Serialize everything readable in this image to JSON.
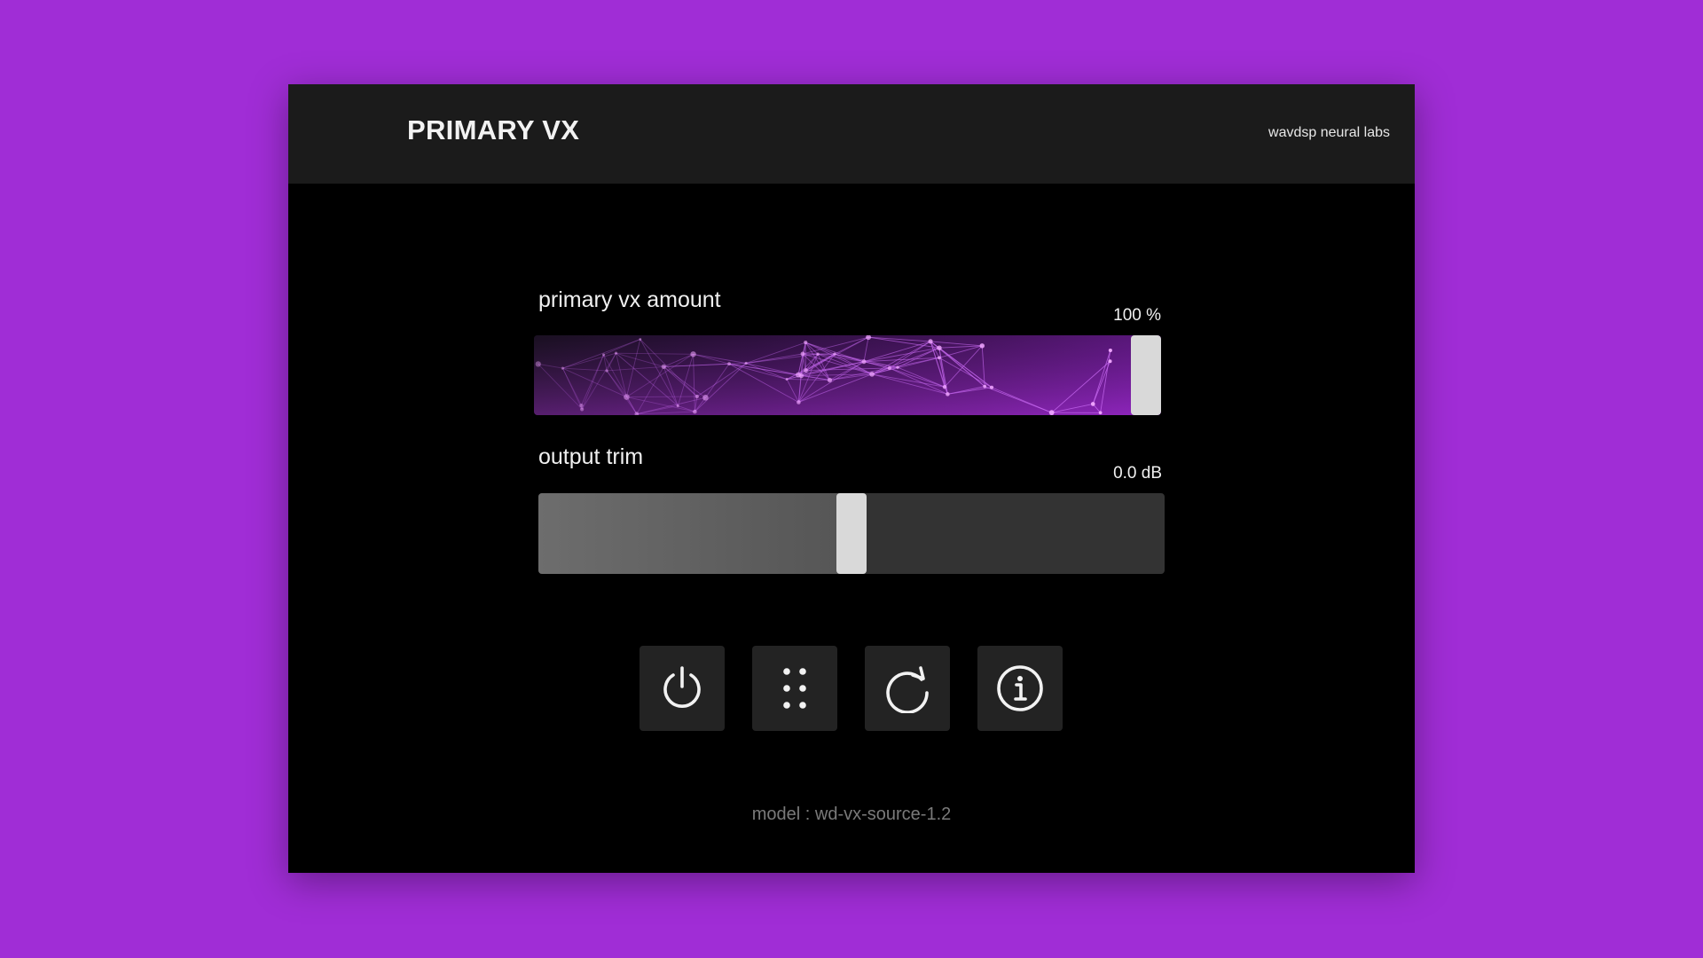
{
  "header": {
    "title": "PRIMARY VX",
    "vendor": "wavdsp neural labs",
    "logo_icon": "waveform-logo-icon"
  },
  "params": {
    "amount": {
      "label": "primary vx amount",
      "value_text": "100 %",
      "level": 1.0
    },
    "trim": {
      "label": "output trim",
      "value_text": "0.0 dB",
      "level": 0.5
    }
  },
  "buttons": [
    {
      "icon": "power-icon"
    },
    {
      "icon": "grid-dots-icon"
    },
    {
      "icon": "reload-icon"
    },
    {
      "icon": "info-icon"
    }
  ],
  "footer": {
    "model": "model : wd-vx-source-1.2"
  },
  "colors": {
    "page_background": "#a02dd6",
    "panel_background": "#000000",
    "header_background": "#1b1b1b",
    "accent": "#c23cf0",
    "logo_gradient": [
      "#2ad0d0",
      "#2a6fe0"
    ]
  }
}
